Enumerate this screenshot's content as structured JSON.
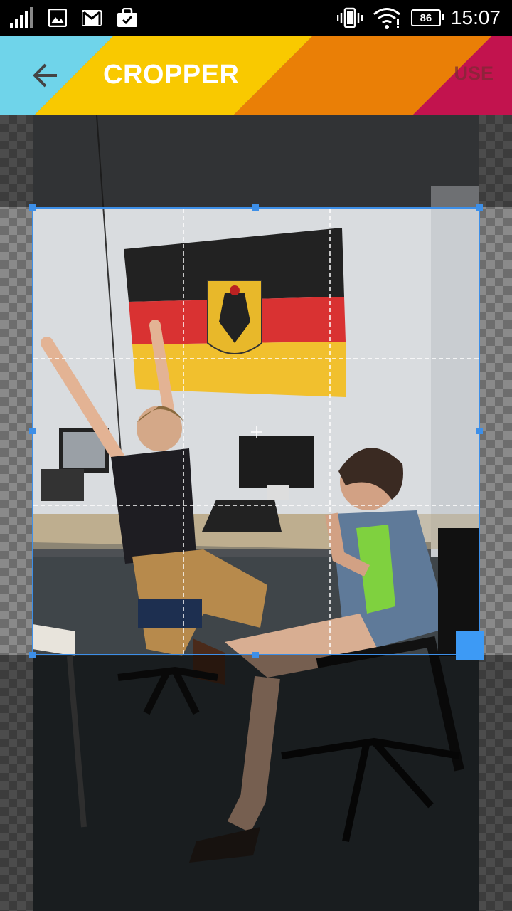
{
  "status_bar": {
    "time": "15:07",
    "battery": "86",
    "icons": [
      "signal-icon",
      "image-notification-icon",
      "gmail-icon",
      "shopping-bag-icon",
      "vibrate-icon",
      "wifi-icon"
    ]
  },
  "toolbar": {
    "title": "CROPPER",
    "use_label": "USE",
    "colors": {
      "cyan": "#6fd4ea",
      "yellow": "#f9c900",
      "orange": "#ea7f06",
      "magenta": "#c2134e",
      "crop_blue": "#3d8fe8"
    }
  },
  "image_editor": {
    "crop_aspect": "1:1"
  }
}
